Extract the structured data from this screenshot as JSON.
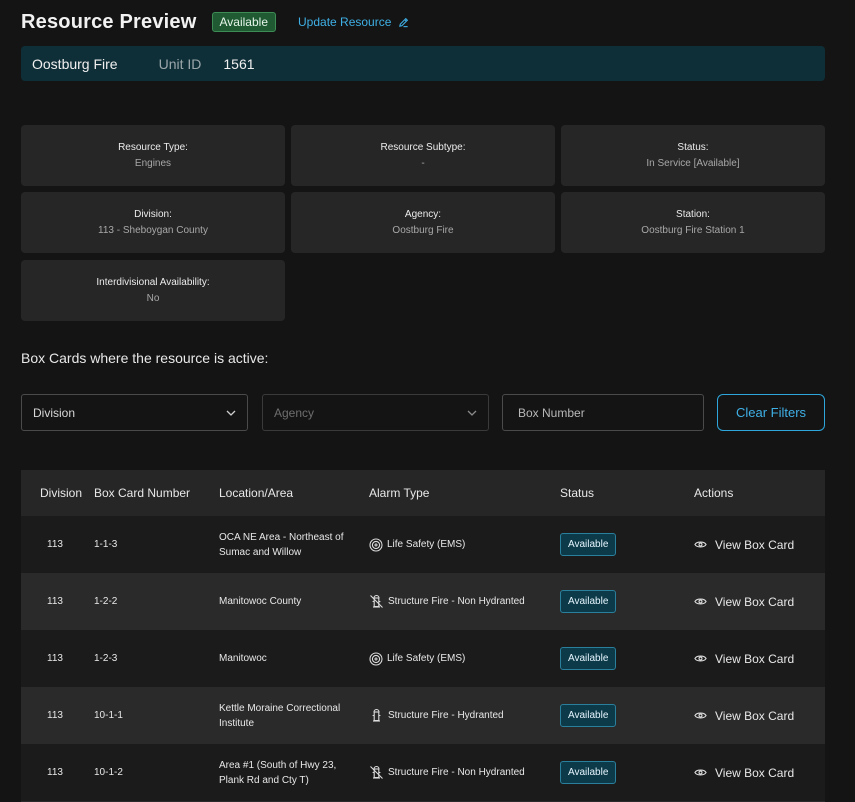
{
  "header": {
    "title": "Resource Preview",
    "badge": "Available",
    "update_link": "Update Resource"
  },
  "unit_bar": {
    "name": "Oostburg Fire",
    "unit_id_label": "Unit ID",
    "unit_id": "1561"
  },
  "details": [
    {
      "label": "Resource Type:",
      "value": "Engines"
    },
    {
      "label": "Resource Subtype:",
      "value": "-"
    },
    {
      "label": "Status:",
      "value": "In Service [Available]"
    },
    {
      "label": "Division:",
      "value": "113 - Sheboygan County"
    },
    {
      "label": "Agency:",
      "value": "Oostburg Fire"
    },
    {
      "label": "Station:",
      "value": "Oostburg Fire Station 1"
    },
    {
      "label": "Interdivisional Availability:",
      "value": "No"
    }
  ],
  "section_title": "Box Cards where the resource is active:",
  "filters": {
    "division_label": "Division",
    "agency_label": "Agency",
    "box_number_placeholder": "Box Number",
    "clear_label": "Clear Filters"
  },
  "table": {
    "headers": [
      "Division",
      "Box Card Number",
      "Location/Area",
      "Alarm Type",
      "Status",
      "Actions"
    ],
    "rows": [
      {
        "division": "113",
        "box": "1-1-3",
        "location": "OCA NE Area - Northeast of Sumac and Willow",
        "alarm": "Life Safety (EMS)",
        "alarm_icon": "life-safety-icon",
        "status": "Available",
        "action": "View Box Card"
      },
      {
        "division": "113",
        "box": "1-2-2",
        "location": "Manitowoc County",
        "alarm": "Structure Fire - Non Hydranted",
        "alarm_icon": "hydrant-crossed-icon",
        "status": "Available",
        "action": "View Box Card"
      },
      {
        "division": "113",
        "box": "1-2-3",
        "location": "Manitowoc",
        "alarm": "Life Safety (EMS)",
        "alarm_icon": "life-safety-icon",
        "status": "Available",
        "action": "View Box Card"
      },
      {
        "division": "113",
        "box": "10-1-1",
        "location": "Kettle Moraine Correctional Institute",
        "alarm": "Structure Fire - Hydranted",
        "alarm_icon": "hydrant-icon",
        "status": "Available",
        "action": "View Box Card"
      },
      {
        "division": "113",
        "box": "10-1-2",
        "location": "Area #1 (South of Hwy 23, Plank Rd and Cty T)",
        "alarm": "Structure Fire - Non Hydranted",
        "alarm_icon": "hydrant-crossed-icon",
        "status": "Available",
        "action": "View Box Card"
      }
    ]
  },
  "colors": {
    "background": "#141414",
    "accent": "#3fb0e6",
    "badge_green": "#1f5a33",
    "status_pill": "#0d3a48"
  }
}
